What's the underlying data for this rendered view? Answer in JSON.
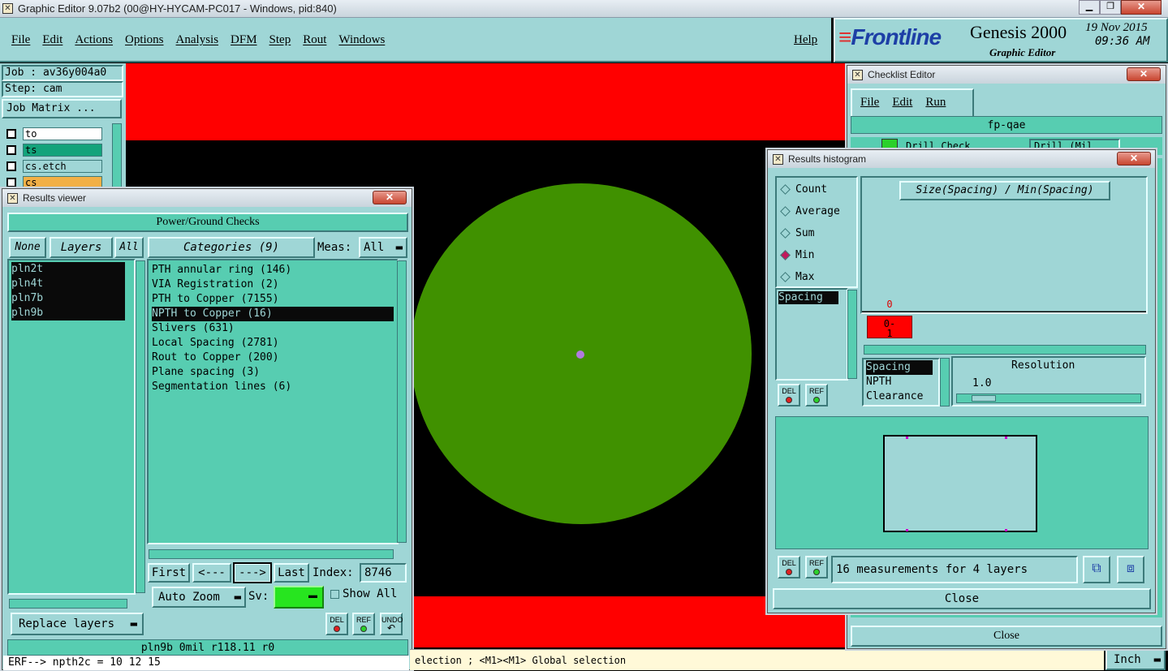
{
  "titlebar": {
    "title": "Graphic Editor 9.07b2 (00@HY-HYCAM-PC017 - Windows, pid:840)"
  },
  "menu": {
    "items": [
      "File",
      "Edit",
      "Actions",
      "Options",
      "Analysis",
      "DFM",
      "Step",
      "Rout",
      "Windows"
    ],
    "help": "Help"
  },
  "brand": {
    "logo": "Frontline",
    "product": "Genesis 2000",
    "subtitle": "Graphic Editor",
    "date": "19 Nov 2015",
    "time": "09:36 AM"
  },
  "left_panel": {
    "job": "Job : av36y004a0",
    "step": "Step: cam",
    "job_matrix": "Job Matrix ...",
    "layers": [
      {
        "name": "to",
        "color": "#ffffff"
      },
      {
        "name": "ts",
        "color": "#13a37b"
      },
      {
        "name": "cs.etch",
        "color": "#9fd6d6"
      },
      {
        "name": "cs",
        "color": "#f2b046"
      }
    ]
  },
  "colors": {
    "canvas_red": "#ff0000",
    "pad_green": "#409100",
    "teal": "#9fd6d6",
    "green": "#57cdb1"
  },
  "results_viewer": {
    "title": "Results viewer",
    "header": "Power/Ground Checks",
    "none_btn": "None",
    "layers_btn": "Layers",
    "all_btn": "All",
    "layers": [
      "pln2t",
      "pln4t",
      "pln7b",
      "pln9b"
    ],
    "categories_btn": "Categories (9)",
    "meas_label": "Meas:",
    "meas_value": "All",
    "categories": [
      "PTH annular ring (146)",
      "VIA Registration (2)",
      "PTH to Copper (7155)",
      "NPTH to Copper (16)",
      "Slivers (631)",
      "Local Spacing (2781)",
      "Rout to Copper (200)",
      "Plane spacing (3)",
      "Segmentation lines (6)"
    ],
    "selected_category": "NPTH to Copper (16)",
    "nav": {
      "first": "First",
      "prev": "<---",
      "next": "--->",
      "last": "Last",
      "index_label": "Index:",
      "index_value": "8746"
    },
    "auto_zoom": "Auto Zoom",
    "sv_label": "Sv:",
    "show_all": "Show All",
    "replace_layers": "Replace layers",
    "del": "DEL",
    "ref": "REF",
    "undo": "UNDO"
  },
  "status": {
    "line1": "pln9b 0mil   r118.11  r0",
    "line2": "ERF--> npth2c = 10 12 15",
    "prompt": "election ; <M1><M1> Global selection",
    "units": "Inch"
  },
  "checklist_editor": {
    "title": "Checklist Editor",
    "menu": [
      "File",
      "Edit",
      "Run"
    ],
    "name": "fp-qae",
    "row_partial": "Drill Check",
    "drill_field": "Drill (Mil",
    "close": "Close"
  },
  "histogram": {
    "title": "Results histogram",
    "modes": [
      "Count",
      "Average",
      "Sum",
      "Min",
      "Max"
    ],
    "selected_mode": "Min",
    "list": [
      "Spacing"
    ],
    "chart_title": "Size(Spacing) / Min(Spacing)",
    "bin_count": "0",
    "bin_label": "0-\n1",
    "measures": [
      "Spacing",
      "NPTH",
      "Clearance"
    ],
    "resolution_label": "Resolution",
    "resolution_value": "1.0",
    "summary": "16 measurements for 4 layers",
    "close": "Close",
    "del": "DEL",
    "ref": "REF"
  },
  "chart_data": {
    "type": "bar",
    "title": "Size(Spacing) / Min(Spacing)",
    "categories": [
      "0-1"
    ],
    "values": [
      0
    ],
    "xlabel": "",
    "ylabel": ""
  }
}
